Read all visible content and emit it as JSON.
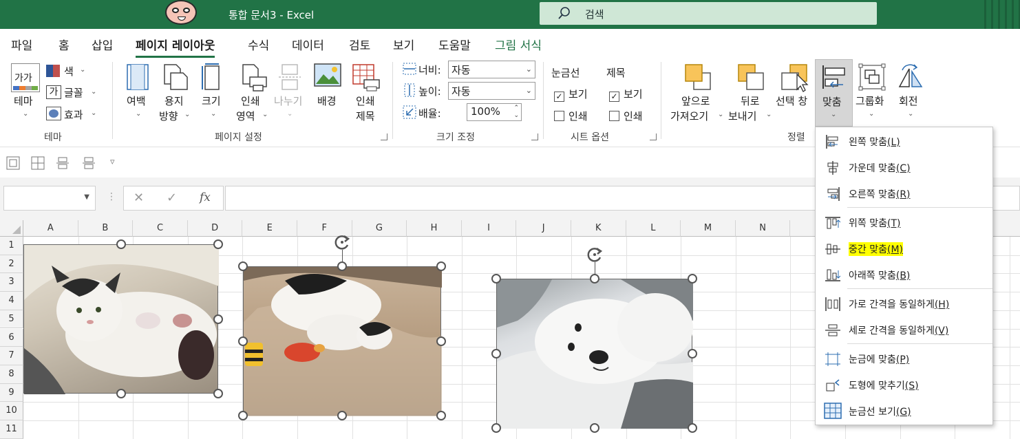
{
  "window": {
    "title": "통합 문서3  -  Excel",
    "search_placeholder": "검색"
  },
  "tabs": [
    {
      "label": "파일"
    },
    {
      "label": "홈"
    },
    {
      "label": "삽입"
    },
    {
      "label": "페이지 레이아웃"
    },
    {
      "label": "수식"
    },
    {
      "label": "데이터"
    },
    {
      "label": "검토"
    },
    {
      "label": "보기"
    },
    {
      "label": "도움말"
    },
    {
      "label": "그림 서식"
    }
  ],
  "ribbon": {
    "theme_group": {
      "name": "테마",
      "themes": "테마",
      "themes_glyph": "가가",
      "colors": "색",
      "fonts": "글꼴",
      "fonts_glyph": "가",
      "effects": "효과"
    },
    "page_setup": {
      "name": "페이지 설정",
      "margins": "여백",
      "orientation_1": "용지",
      "orientation_2": "방향",
      "size": "크기",
      "print_area_1": "인쇄",
      "print_area_2": "영역",
      "breaks": "나누기",
      "background": "배경",
      "print_titles_1": "인쇄",
      "print_titles_2": "제목"
    },
    "scale": {
      "name": "크기 조정",
      "width_label": "너비:",
      "width_value": "자동",
      "height_label": "높이:",
      "height_value": "자동",
      "scale_label": "배율:",
      "scale_value": "100%"
    },
    "sheet_options": {
      "name": "시트 옵션",
      "gridlines": "눈금선",
      "headings": "제목",
      "view": "보기",
      "print": "인쇄",
      "gridlines_view_checked": true,
      "headings_view_checked": true
    },
    "arrange": {
      "name": "정렬",
      "bring_forward_1": "앞으로",
      "bring_forward_2": "가져오기",
      "send_backward_1": "뒤로",
      "send_backward_2": "보내기",
      "selection_pane": "선택 창",
      "align": "맞춤",
      "group": "그룹화",
      "rotate": "회전"
    }
  },
  "columns": [
    "A",
    "B",
    "C",
    "D",
    "E",
    "F",
    "G",
    "H",
    "I",
    "J",
    "K",
    "L",
    "M",
    "N"
  ],
  "rows": [
    "1",
    "2",
    "3",
    "4",
    "5",
    "6",
    "7",
    "8",
    "9",
    "10",
    "11"
  ],
  "align_menu": {
    "items": [
      {
        "label": "왼쪽 맞춤",
        "key": "(L)"
      },
      {
        "label": "가운데 맞춤",
        "key": "(C)"
      },
      {
        "label": "오른쪽 맞춤",
        "key": "(R)"
      },
      {
        "label": "위쪽 맞춤",
        "key": "(T)"
      },
      {
        "label": "중간 맞춤",
        "key": "(M)"
      },
      {
        "label": "아래쪽 맞춤",
        "key": "(B)"
      },
      {
        "label": "가로 간격을 동일하게",
        "key": "(H)"
      },
      {
        "label": "세로 간격을 동일하게",
        "key": "(V)"
      },
      {
        "label": "눈금에 맞춤",
        "key": "(P)"
      },
      {
        "label": "도형에 맞추기",
        "key": "(S)"
      },
      {
        "label": "눈금선 보기",
        "key": "(G)"
      }
    ],
    "highlighted_item": "중간 맞춤"
  },
  "colors": {
    "excel_green": "#217346",
    "highlight": "#ffff00",
    "ribbon_orange": "#f8c45a"
  }
}
